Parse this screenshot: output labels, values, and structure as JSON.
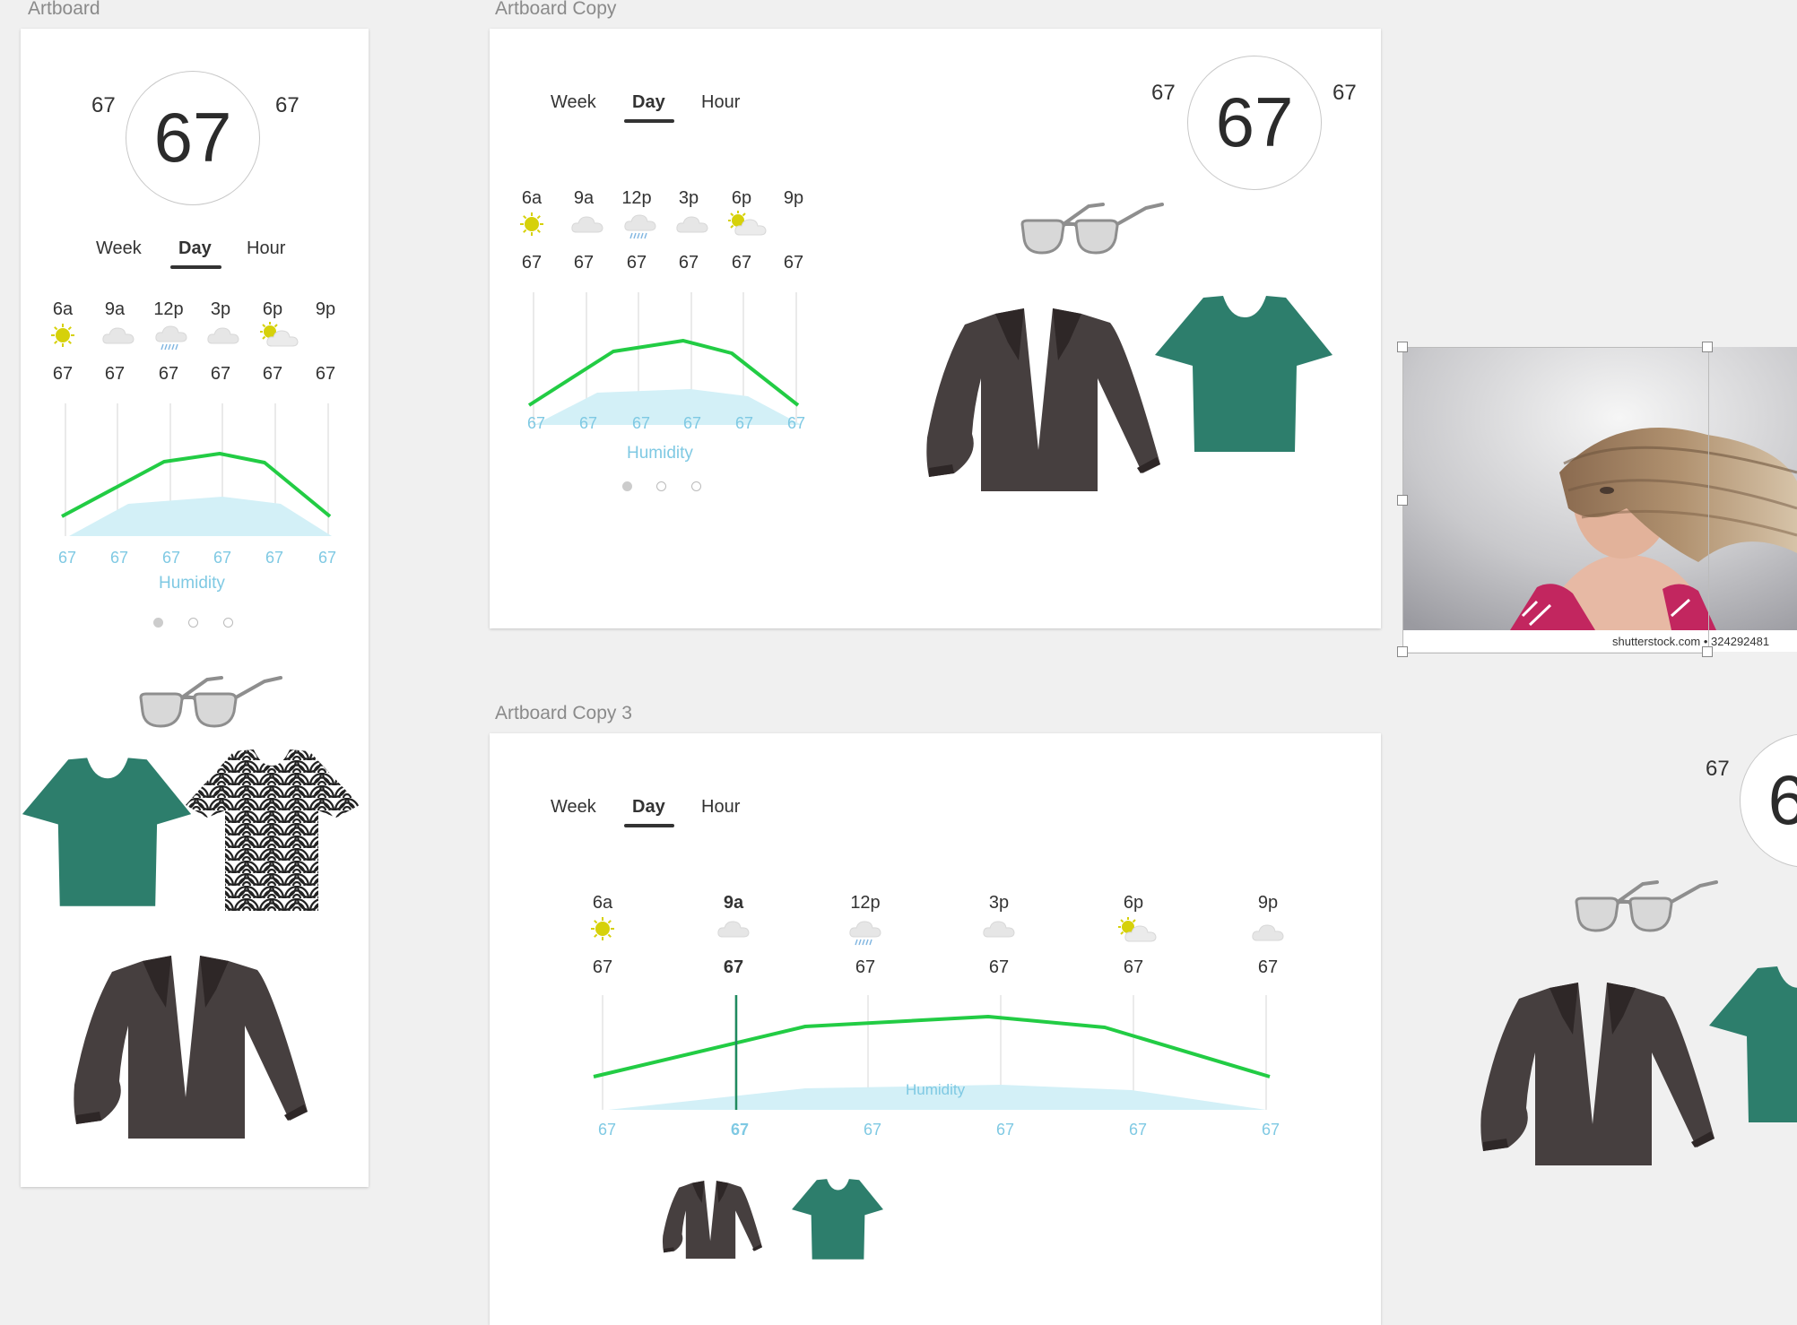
{
  "artboards": {
    "a1": {
      "label": "Artboard"
    },
    "a2": {
      "label": "Artboard Copy"
    },
    "a3": {
      "label": "Artboard Copy 3"
    }
  },
  "weather": {
    "current_temp": "67",
    "low": "67",
    "high": "67",
    "tabs": [
      "Week",
      "Day",
      "Hour"
    ],
    "active_tab": "Day",
    "hours": [
      "6a",
      "9a",
      "12p",
      "3p",
      "6p",
      "9p"
    ],
    "icons": [
      "sun-icon",
      "cloud-icon",
      "rain-cloud-icon",
      "cloud-icon",
      "partly-cloudy-icon",
      "cloud-icon"
    ],
    "temps": [
      "67",
      "67",
      "67",
      "67",
      "67",
      "67"
    ],
    "humidity_values": [
      "67",
      "67",
      "67",
      "67",
      "67",
      "67"
    ],
    "humidity_label": "Humidity",
    "selected_hour": "9a"
  },
  "photo": {
    "caption": "shutterstock.com • 324292481"
  },
  "colors": {
    "temp_line": "#22cc44",
    "humidity_fill": "#d3f0f7",
    "humidity_text": "#7fc9e3",
    "shirt": "#2d7e6c",
    "jacket": "#463f3f",
    "jacket_dark": "#2e2727",
    "sun": "#d6d10a",
    "cloud": "#e6e6e6"
  }
}
